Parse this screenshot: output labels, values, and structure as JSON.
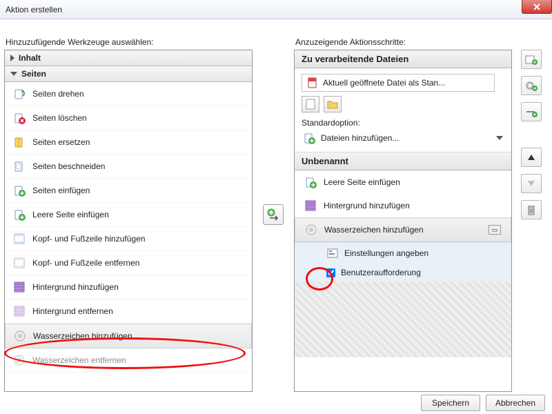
{
  "window": {
    "title": "Aktion erstellen"
  },
  "left": {
    "label": "Hinzuzufügende Werkzeuge auswählen:",
    "groups": {
      "content": "Inhalt",
      "pages": "Seiten"
    },
    "items": [
      {
        "id": "rotate",
        "label": "Seiten drehen"
      },
      {
        "id": "delete",
        "label": "Seiten löschen"
      },
      {
        "id": "replace",
        "label": "Seiten ersetzen"
      },
      {
        "id": "crop",
        "label": "Seiten beschneiden"
      },
      {
        "id": "insert",
        "label": "Seiten einfügen"
      },
      {
        "id": "blank",
        "label": "Leere Seite einfügen"
      },
      {
        "id": "hf-add",
        "label": "Kopf- und Fußzeile hinzufügen"
      },
      {
        "id": "hf-rem",
        "label": "Kopf- und Fußzeile entfernen"
      },
      {
        "id": "bg-add",
        "label": "Hintergrund hinzufügen"
      },
      {
        "id": "bg-rem",
        "label": "Hintergrund entfernen"
      },
      {
        "id": "wm-add",
        "label": "Wasserzeichen hinzufügen"
      },
      {
        "id": "wm-rem",
        "label": "Wasserzeichen entfernen"
      }
    ]
  },
  "right": {
    "label": "Anzuzeigende Aktionsschritte:",
    "files_header": "Zu verarbeitende Dateien",
    "current_file": "Aktuell geöffnete Datei als Stan...",
    "std_label": "Standardoption:",
    "std_value": "Dateien hinzufügen...",
    "group_name": "Unbenannt",
    "steps": [
      {
        "id": "blank",
        "label": "Leere Seite einfügen"
      },
      {
        "id": "bg",
        "label": "Hintergrund hinzufügen"
      },
      {
        "id": "wm",
        "label": "Wasserzeichen hinzufügen",
        "selected": true
      }
    ],
    "sub": {
      "settings": "Einstellungen angeben",
      "prompt": "Benutzeraufforderung"
    }
  },
  "buttons": {
    "save": "Speichern",
    "cancel": "Abbrechen"
  }
}
